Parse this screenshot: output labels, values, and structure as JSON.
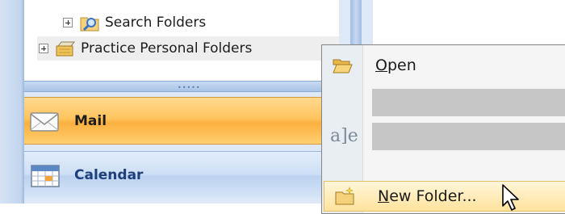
{
  "folders": {
    "search_folders": "Search Folders",
    "practice_personal_folders": "Practice Personal Folders"
  },
  "splitter": {
    "grip": "•••••"
  },
  "nav": {
    "mail": "Mail",
    "calendar": "Calendar"
  },
  "context_menu": {
    "open": {
      "underlined": "O",
      "rest": "pen"
    },
    "rename_glyph": "a]e",
    "new_folder": {
      "underlined": "N",
      "rest": "ew Folder..."
    }
  },
  "icons": {
    "search_folders": "search-folder-icon",
    "personal_folders": "personal-folders-icon",
    "mail": "envelope-icon",
    "calendar": "calendar-icon",
    "open": "open-folder-icon",
    "rename": "rename-icon",
    "new_folder": "new-folder-icon",
    "cursor": "mouse-pointer-icon"
  },
  "colors": {
    "selected_nav": "#ffc45e",
    "calendar_nav": "#cddff5",
    "menu_hover": "#ffe39d",
    "menu_disabled": "#c6c6c6"
  }
}
